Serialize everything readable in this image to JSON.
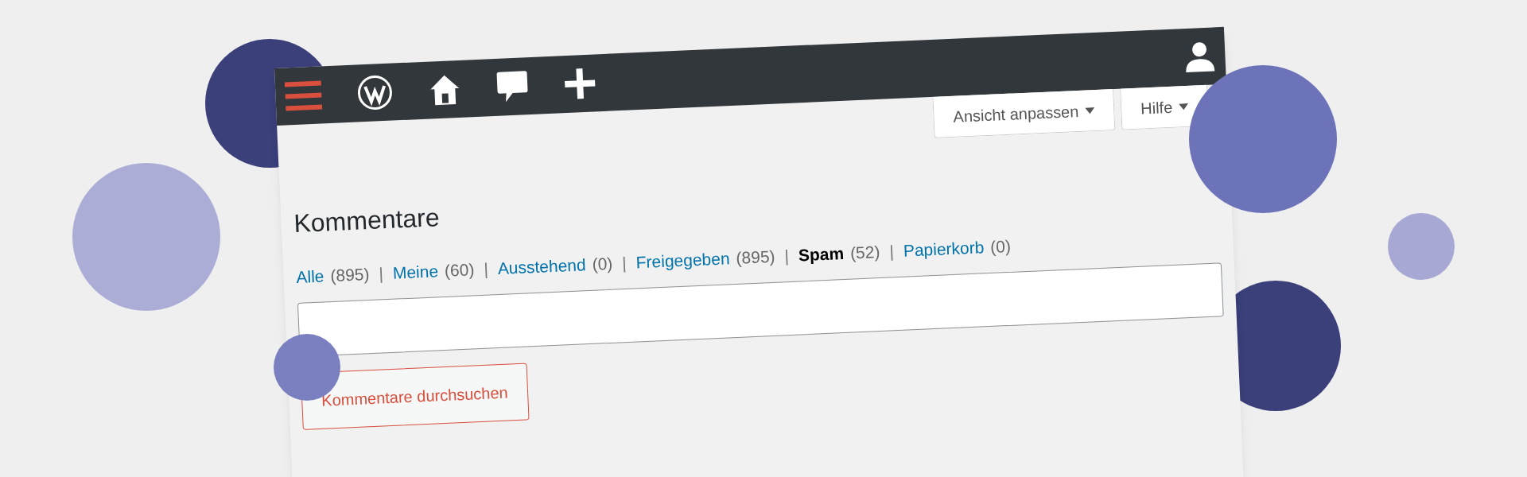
{
  "screen_options": [
    {
      "label": "Ansicht anpassen"
    },
    {
      "label": "Hilfe"
    }
  ],
  "title": "Kommentare",
  "filters": [
    {
      "label": "Alle",
      "count": "(895)",
      "selected": false
    },
    {
      "separator": "|",
      "label": "Meine",
      "count": "(60)",
      "selected": false
    },
    {
      "separator": "|",
      "label": "Ausstehend",
      "count": "(0)",
      "selected": false
    },
    {
      "separator": "|",
      "label": "Freigegeben",
      "count": "(895)",
      "selected": false
    },
    {
      "separator": "|",
      "label": "Spam",
      "count": "(52)",
      "selected": true
    },
    {
      "separator": "|",
      "label": "Papierkorb",
      "count": "(0)",
      "selected": false
    }
  ],
  "search": {
    "button": "Kommentare durchsuchen"
  }
}
